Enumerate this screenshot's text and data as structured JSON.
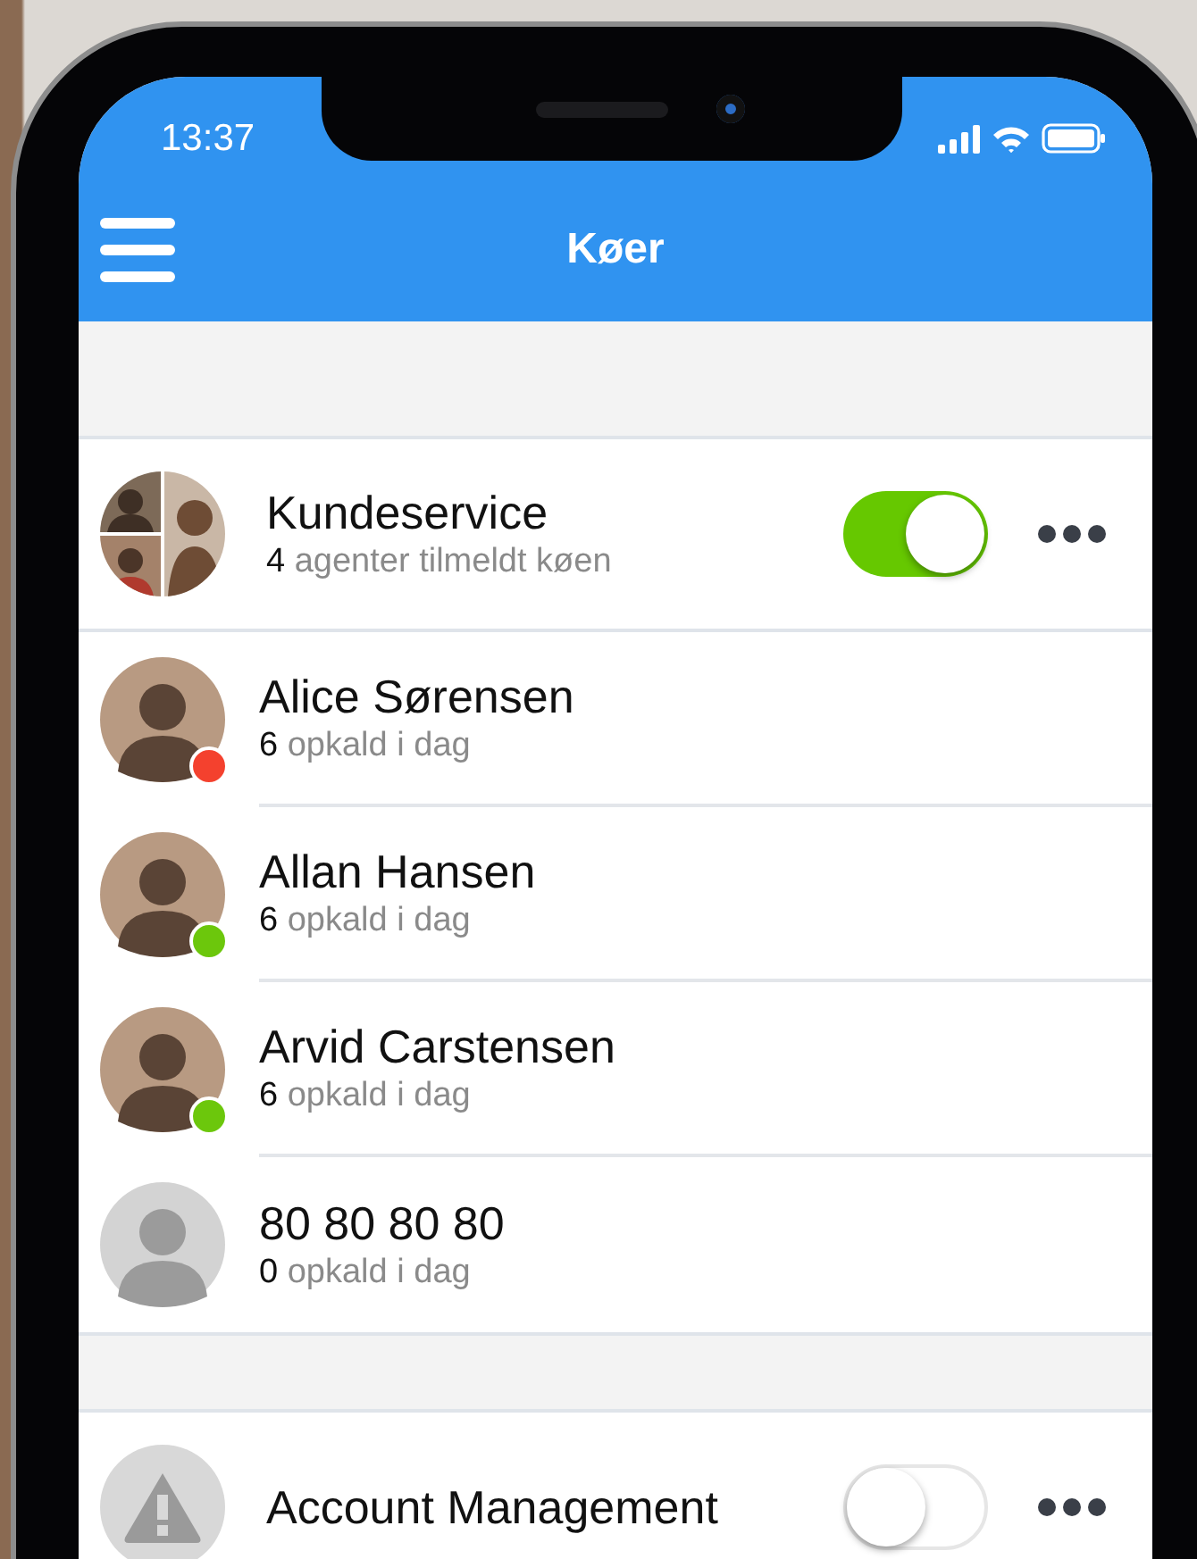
{
  "status_bar": {
    "time": "13:37"
  },
  "nav_bar": {
    "title": "Køer"
  },
  "queues": [
    {
      "name": "Kundeservice",
      "count": "4",
      "subtitle": "agenter tilmeldt køen",
      "kind": "group",
      "enabled": true,
      "agents": [
        {
          "name": "Alice Sørensen",
          "count": "6",
          "subtitle": "opkald i dag",
          "kind": "photo",
          "color": "#f4412e"
        },
        {
          "name": "Allan Hansen",
          "count": "6",
          "subtitle": "opkald i dag",
          "kind": "photo",
          "color": "#6cc70c"
        },
        {
          "name": "Arvid Carstensen",
          "count": "6",
          "subtitle": "opkald i dag",
          "kind": "photo",
          "color": "#6cc70c"
        },
        {
          "name": "80 80 80 80",
          "count": "0",
          "subtitle": "opkald i dag",
          "kind": "placeholder"
        }
      ]
    },
    {
      "name": "Account Management",
      "kind": "warning",
      "enabled": false
    }
  ]
}
